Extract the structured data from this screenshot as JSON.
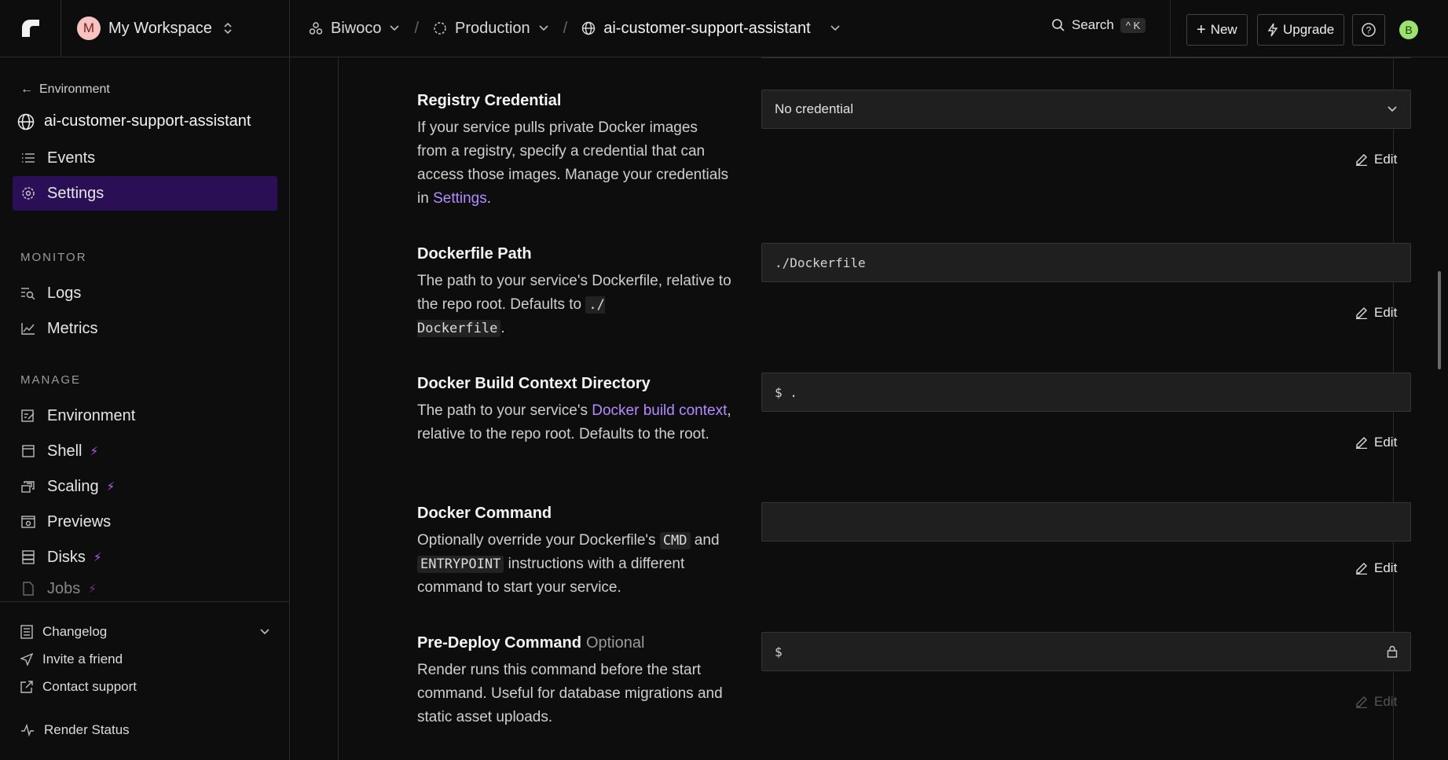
{
  "workspace": {
    "initial": "M",
    "name": "My Workspace"
  },
  "breadcrumbs": [
    {
      "label": "Biwoco",
      "icon": "team-icon"
    },
    {
      "label": "Production",
      "icon": "environment-icon"
    },
    {
      "label": "ai-customer-support-assistant",
      "icon": "globe-icon"
    }
  ],
  "topbar": {
    "search_label": "Search",
    "search_shortcut": "^ K",
    "new_label": "New",
    "upgrade_label": "Upgrade",
    "user_initial": "B"
  },
  "sidebar": {
    "back_label": "Environment",
    "service_name": "ai-customer-support-assistant",
    "primary": [
      {
        "label": "Events",
        "icon": "list-icon"
      },
      {
        "label": "Settings",
        "icon": "gear-icon",
        "active": true
      }
    ],
    "monitor_label": "MONITOR",
    "monitor": [
      {
        "label": "Logs",
        "icon": "logs-icon"
      },
      {
        "label": "Metrics",
        "icon": "chart-icon"
      }
    ],
    "manage_label": "MANAGE",
    "manage": [
      {
        "label": "Environment",
        "icon": "edit-list-icon"
      },
      {
        "label": "Shell",
        "icon": "terminal-icon",
        "pro": true
      },
      {
        "label": "Scaling",
        "icon": "scaling-icon",
        "pro": true
      },
      {
        "label": "Previews",
        "icon": "preview-icon"
      },
      {
        "label": "Disks",
        "icon": "disk-icon",
        "pro": true
      },
      {
        "label": "Jobs",
        "icon": "jobs-icon",
        "pro": true
      }
    ],
    "footer": {
      "changelog": "Changelog",
      "invite": "Invite a friend",
      "contact": "Contact support",
      "status": "Render Status"
    }
  },
  "settings": {
    "registry": {
      "title": "Registry Credential",
      "desc_prefix": "If your service pulls private Docker images from a registry, specify a credential that can access those images. Manage your credentials in ",
      "desc_link": "Settings",
      "desc_suffix": ".",
      "value": "No credential",
      "edit": "Edit"
    },
    "dockerfile": {
      "title": "Dockerfile Path",
      "desc_prefix": "The path to your service's Dockerfile, relative to the repo root. Defaults to ",
      "desc_code": "./\nDockerfile",
      "desc_suffix": ".",
      "value": "./Dockerfile",
      "edit": "Edit"
    },
    "context": {
      "title": "Docker Build Context Directory",
      "desc_prefix": "The path to your service's ",
      "desc_link": "Docker build context",
      "desc_suffix": ", relative to the repo root. Defaults to the root.",
      "value": "$ .",
      "edit": "Edit"
    },
    "command": {
      "title": "Docker Command",
      "desc_prefix": "Optionally override your Dockerfile's ",
      "code1": "CMD",
      "desc_mid": " and ",
      "code2": "ENTRYPOINT",
      "desc_suffix": " instructions with a different command to start your service.",
      "value": "",
      "edit": "Edit"
    },
    "predeploy": {
      "title": "Pre-Deploy Command",
      "optional": "Optional",
      "desc": "Render runs this command before the start command. Useful for database migrations and static asset uploads.",
      "value": "$",
      "edit": "Edit"
    }
  }
}
